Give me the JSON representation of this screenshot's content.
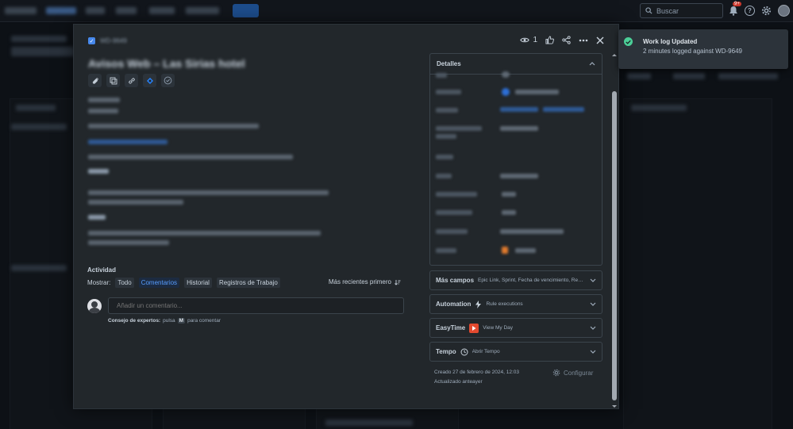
{
  "top_search": {
    "placeholder": "Buscar"
  },
  "notifications": {
    "badge": "9+"
  },
  "modal": {
    "watch_count": "1",
    "activity": {
      "title": "Actividad",
      "show_label": "Mostrar:",
      "filters": [
        "Todo",
        "Comentarios",
        "Historial",
        "Registros de Trabajo"
      ],
      "selected_filter": "Comentarios",
      "sort_label": "Más recientes primero",
      "comment_placeholder": "Añadir un comentario...",
      "tip_prefix": "Consejo de expertos:",
      "tip_middle": "pulsa",
      "tip_key": "M",
      "tip_suffix": "para comentar"
    },
    "details": {
      "title": "Detalles"
    },
    "sections": [
      {
        "name": "Más campos",
        "sub": "Epic Link, Sprint, Fecha de vencimiento, Registrar..."
      },
      {
        "name": "Automation",
        "sub": "Rule executions"
      },
      {
        "name": "EasyTime",
        "sub": "View My Day"
      },
      {
        "name": "Tempo",
        "sub": "Abrir Tempo"
      }
    ],
    "meta": {
      "created": "Creado 27 de febrero de 2024, 12:03",
      "updated": "Actualizado anteayer"
    },
    "configure_label": "Configurar"
  },
  "toast": {
    "title": "Work log Updated",
    "message": "2 minutes logged against WD-9649"
  },
  "colors": {
    "accent": "#579dff",
    "success": "#4bce97",
    "surface": "#22272b"
  }
}
